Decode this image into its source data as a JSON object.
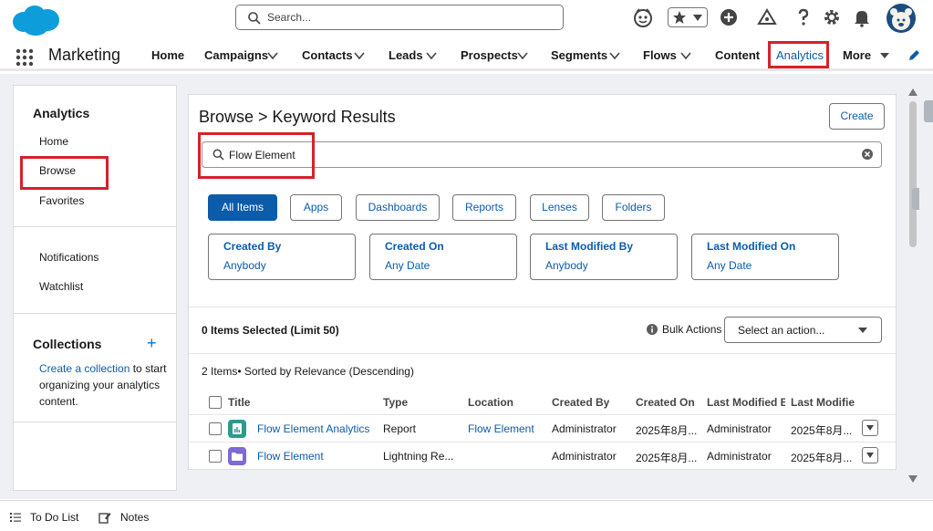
{
  "topbar": {
    "search_placeholder": "Search...",
    "icons": [
      "salesforce-logo",
      "agent-icon",
      "favorites-star-icon",
      "add-icon",
      "trailhead-icon",
      "help-icon",
      "setup-gear-icon",
      "notifications-bell-icon",
      "avatar"
    ]
  },
  "nav": {
    "app_name": "Marketing",
    "items": [
      {
        "label": "Home",
        "dropdown": false
      },
      {
        "label": "Campaigns",
        "dropdown": true
      },
      {
        "label": "Contacts",
        "dropdown": true
      },
      {
        "label": "Leads",
        "dropdown": true
      },
      {
        "label": "Prospects",
        "dropdown": true
      },
      {
        "label": "Segments",
        "dropdown": true
      },
      {
        "label": "Flows",
        "dropdown": true
      },
      {
        "label": "Content",
        "dropdown": false
      },
      {
        "label": "Analytics",
        "dropdown": false,
        "active": true
      },
      {
        "label": "More",
        "dropdown": true
      }
    ]
  },
  "left_panel": {
    "title": "Analytics",
    "items": [
      "Home",
      "Browse",
      "Favorites"
    ],
    "items2": [
      "Notifications",
      "Watchlist"
    ],
    "collections_title": "Collections",
    "collections_link": "Create a collection",
    "collections_text": " to start organizing your analytics content."
  },
  "main": {
    "title": "Browse > Keyword Results",
    "create_label": "Create",
    "keyword_value": "Flow Element",
    "type_filters": [
      "All Items",
      "Apps",
      "Dashboards",
      "Reports",
      "Lenses",
      "Folders"
    ],
    "active_type": "All Items",
    "filters": [
      {
        "label": "Created By",
        "value": "Anybody"
      },
      {
        "label": "Created On",
        "value": "Any Date"
      },
      {
        "label": "Last Modified By",
        "value": "Anybody"
      },
      {
        "label": "Last Modified On",
        "value": "Any Date"
      }
    ],
    "selected_count": "0 Items Selected (Limit 50)",
    "bulk_label": "Bulk Actions",
    "action_placeholder": "Select an action...",
    "sort_info": "2 Items• Sorted by Relevance (Descending)",
    "columns": [
      "Title",
      "Type",
      "Location",
      "Created By",
      "Created On",
      "Last Modified B",
      "Last Modifie"
    ],
    "rows": [
      {
        "title": "Flow Element Analytics",
        "type": "Report",
        "location": "Flow Element",
        "created_by": "Administrator",
        "created_on": "2025年8月...",
        "modified_by": "Administrator",
        "modified_on": "2025年8月...",
        "icon": "report-icon",
        "icon_color": "#2e9a8c"
      },
      {
        "title": "Flow Element",
        "type": "Lightning Re...",
        "location": "",
        "created_by": "Administrator",
        "created_on": "2025年8月...",
        "modified_by": "Administrator",
        "modified_on": "2025年8月...",
        "icon": "folder-icon",
        "icon_color": "#7f6ad6"
      }
    ]
  },
  "utility_bar": {
    "items": [
      "To Do List",
      "Notes"
    ]
  },
  "colors": {
    "brand": "#0b5cab",
    "highlight": "#d5212b",
    "page_bg": "#eef0f3"
  }
}
